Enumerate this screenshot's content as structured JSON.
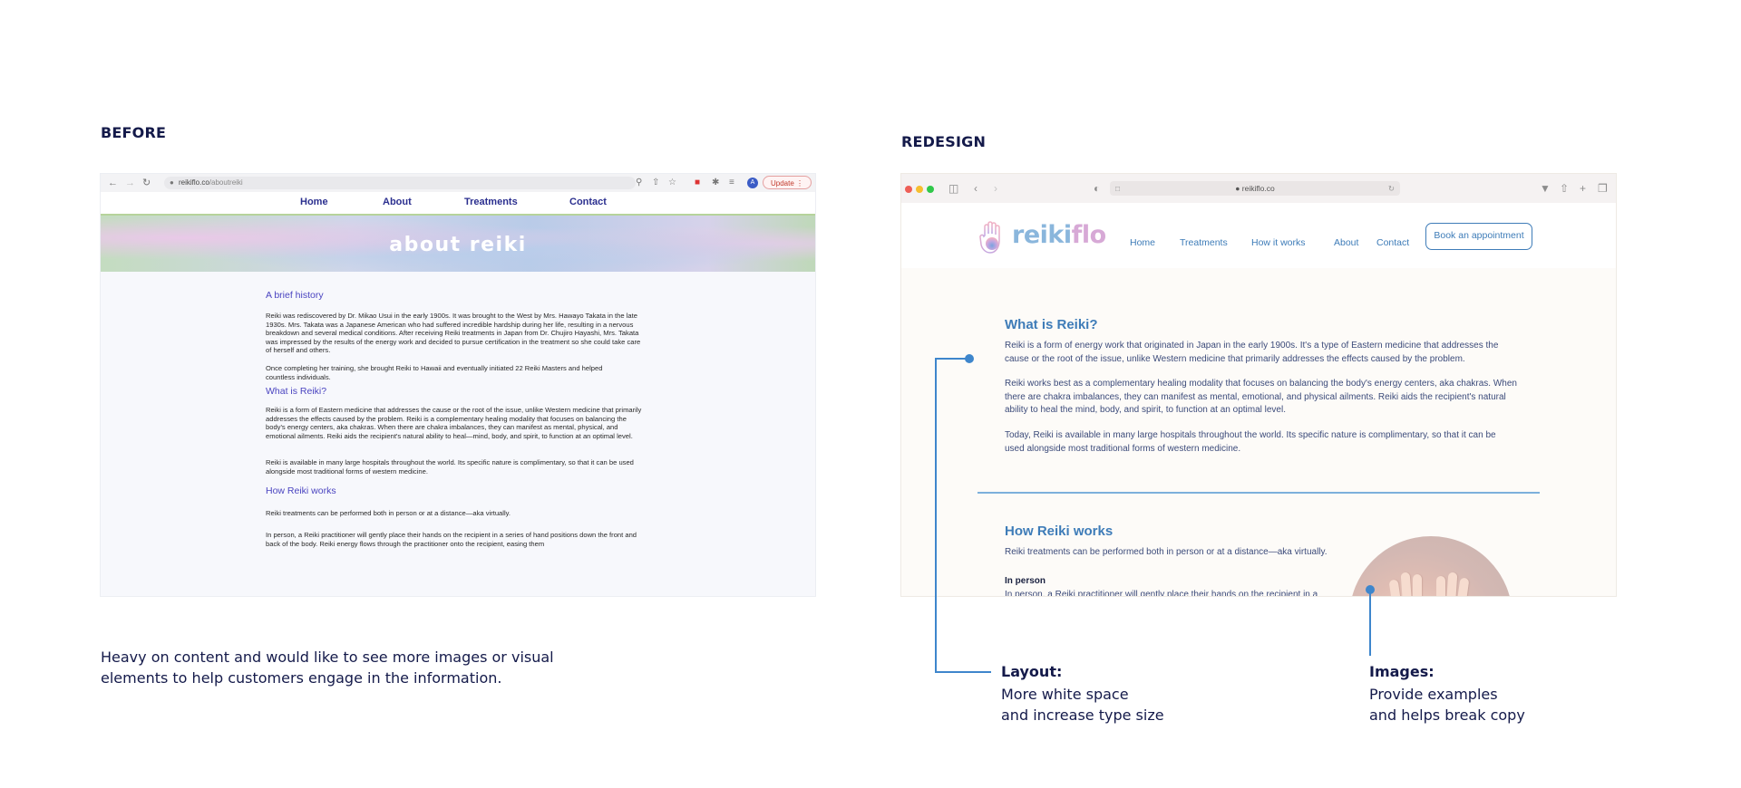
{
  "before": {
    "section_title": "BEFORE",
    "browser": {
      "url_domain": "reikiflo.co",
      "url_path": "/aboutreiki",
      "update_label": "Update",
      "avatar_letter": "A"
    },
    "nav": [
      "Home",
      "About",
      "Treatments",
      "Contact"
    ],
    "hero_title": "about reiki",
    "h_history": "A brief history",
    "p_history_1": "Reiki was rediscovered by Dr. Mikao Usui in the early 1900s. It was brought to the West by Mrs. Hawayo Takata in the late 1930s. Mrs. Takata was a Japanese American who had suffered incredible hardship during her life, resulting in a nervous breakdown and several medical conditions. After receiving Reiki treatments in Japan from Dr. Chujiro Hayashi, Mrs. Takata was impressed by the results of the energy work and decided to pursue certification in the treatment so she could take care of herself and others.",
    "p_history_2": "Once completing her training, she brought Reiki to Hawaii and eventually initiated 22 Reiki Masters and helped countless individuals.",
    "h_what": "What is Reiki?",
    "p_what_1": "Reiki is a form of Eastern medicine that addresses the cause or the root of the issue, unlike Western medicine that primarily addresses the effects caused by the problem. Reiki is a complementary healing modality that focuses on balancing the body's energy centers, aka chakras. When there are chakra imbalances, they can manifest as mental, physical, and emotional ailments. Reiki aids the recipient's natural ability to heal—mind, body, and spirit, to function at an optimal level.",
    "p_what_2": "Reiki is available in many large hospitals throughout the world. Its specific nature is complimentary, so that it can be used alongside most traditional forms of western medicine.",
    "h_how": "How Reiki works",
    "p_how_1": "Reiki treatments can be performed both in person or at a distance—aka virtually.",
    "p_how_2": "In person, a Reiki practitioner will gently place their hands on the recipient in a series of hand positions down the front and back of the body. Reiki energy flows through the practitioner onto the recipient, easing them",
    "note": "Heavy on content and would like to see more images or visual elements to help customers engage in the information."
  },
  "redesign": {
    "section_title": "REDESIGN",
    "browser": {
      "url": "reikiflo.co"
    },
    "logo": {
      "part1": "reiki",
      "part2": "flo"
    },
    "nav": [
      "Home",
      "Treatments",
      "How it works",
      "About",
      "Contact"
    ],
    "cta": "Book an appointment",
    "h_what": "What is Reiki?",
    "p_what_1": "Reiki is a form of energy work that originated in Japan in the early 1900s. It's a type of Eastern medicine that addresses the cause or the root of the issue, unlike Western medicine that primarily addresses the effects caused by the problem.",
    "p_what_2": "Reiki works best as a complementary healing modality that focuses on balancing the body's energy centers, aka chakras. When there are chakra imbalances, they can manifest as mental, emotional, and physical ailments. Reiki aids the recipient's natural ability to heal the mind, body, and spirit, to function at an optimal level.",
    "p_what_3": "Today, Reiki is available in many large hospitals throughout the world. Its specific nature is complimentary, so that it can be used alongside most traditional forms of western medicine.",
    "h_how": "How Reiki works",
    "p_how_1": "Reiki treatments can be performed both in person or at a distance—aka virtually.",
    "sub_in_person": "In person",
    "p_in_person": "In person, a Reiki practitioner will gently place their hands on the recipient in a"
  },
  "annotations": {
    "layout_title": "Layout:",
    "layout_line1": "More white space",
    "layout_line2": "and increase type size",
    "images_title": "Images:",
    "images_line1": "Provide examples",
    "images_line2": "and helps break copy"
  },
  "colors": {
    "accent_blue": "#3e7cb8",
    "navy_text": "#141a4a",
    "purple_heading": "#4a44c0"
  }
}
